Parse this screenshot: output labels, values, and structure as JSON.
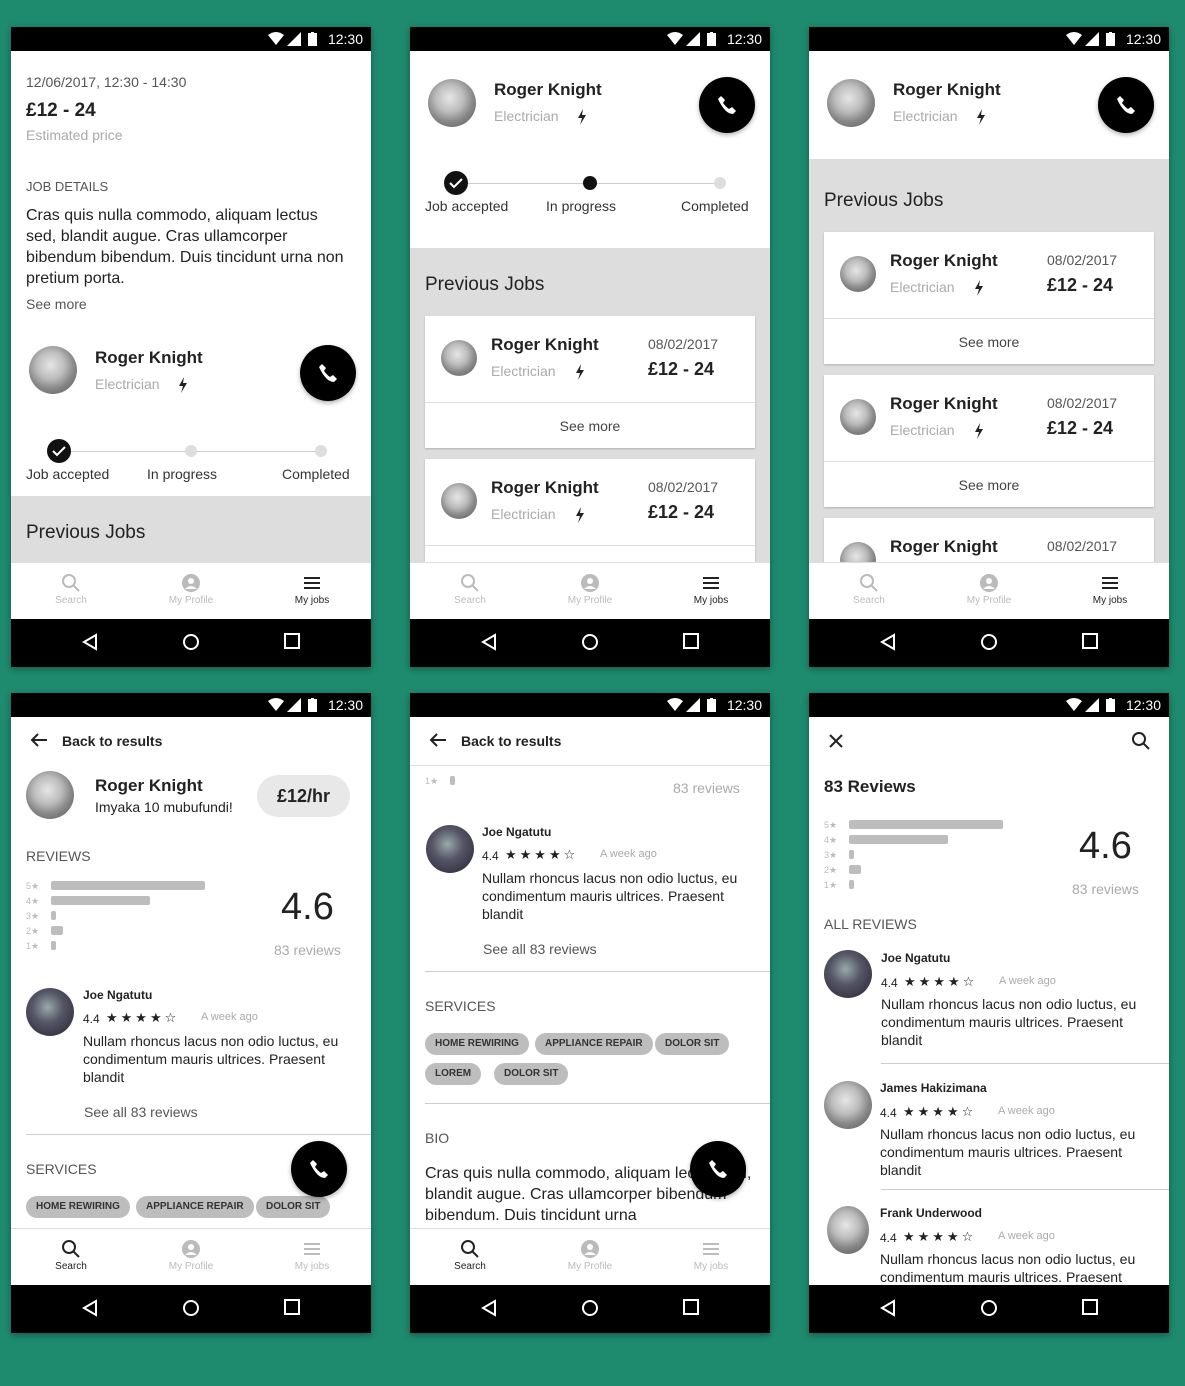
{
  "status_time": "12:30",
  "nav": {
    "search": "Search",
    "profile": "My Profile",
    "jobs": "My jobs"
  },
  "person": {
    "name": "Roger Knight",
    "role": "Electrician",
    "tagline": "Imyaka 10 mubufundi!",
    "rate": "£12/hr"
  },
  "job": {
    "datetime": "12/06/2017, 12:30 - 14:30",
    "price": "£12 - 24",
    "price_label": "Estimated price",
    "details_heading": "JOB DETAILS",
    "details_text": "Cras quis nulla commodo, aliquam lectus sed, blandit augue. Cras ullamcorper bibendum bibendum. Duis tincidunt urna non pretium porta.",
    "see_more": "See more"
  },
  "progress": {
    "steps": [
      "Job accepted",
      "In progress",
      "Completed"
    ]
  },
  "previous": {
    "heading": "Previous Jobs",
    "date": "08/02/2017",
    "price": "£12 - 24",
    "see_more": "See more"
  },
  "profile": {
    "back": "Back to results",
    "reviews_heading": "REVIEWS",
    "rating": "4.6",
    "reviews_count": "83 reviews",
    "see_all": "See all 83 reviews",
    "services_heading": "SERVICES",
    "services": [
      "HOME REWIRING",
      "APPLIANCE REPAIR",
      "DOLOR SIT",
      "LOREM",
      "DOLOR SIT"
    ],
    "bio_heading": "BIO",
    "bio_text": "Cras quis nulla commodo, aliquam lectus sed, blandit augue. Cras ullamcorper bibendum bibendum. Duis tincidunt urna",
    "star_labels": [
      "5★",
      "4★",
      "3★",
      "2★",
      "1★"
    ]
  },
  "review_bars": [
    0.9,
    0.58,
    0.03,
    0.07,
    0.03
  ],
  "reviews": {
    "title": "83 Reviews",
    "all_heading": "ALL REVIEWS",
    "ago": "A week ago",
    "score": "4.4",
    "text": "Nullam rhoncus lacus non odio luctus, eu condimentum mauris ultrices. Praesent blandit",
    "items": [
      {
        "name": "Joe Ngatutu"
      },
      {
        "name": "James Hakizimana"
      },
      {
        "name": "Frank Underwood"
      }
    ]
  },
  "icons": [
    "wifi-icon",
    "signal-icon",
    "battery-icon",
    "phone-icon",
    "bolt-icon",
    "check-icon",
    "search-icon",
    "profile-icon",
    "list-icon",
    "back-icon",
    "close-icon",
    "nav-back-icon",
    "nav-home-icon",
    "nav-recents-icon"
  ]
}
